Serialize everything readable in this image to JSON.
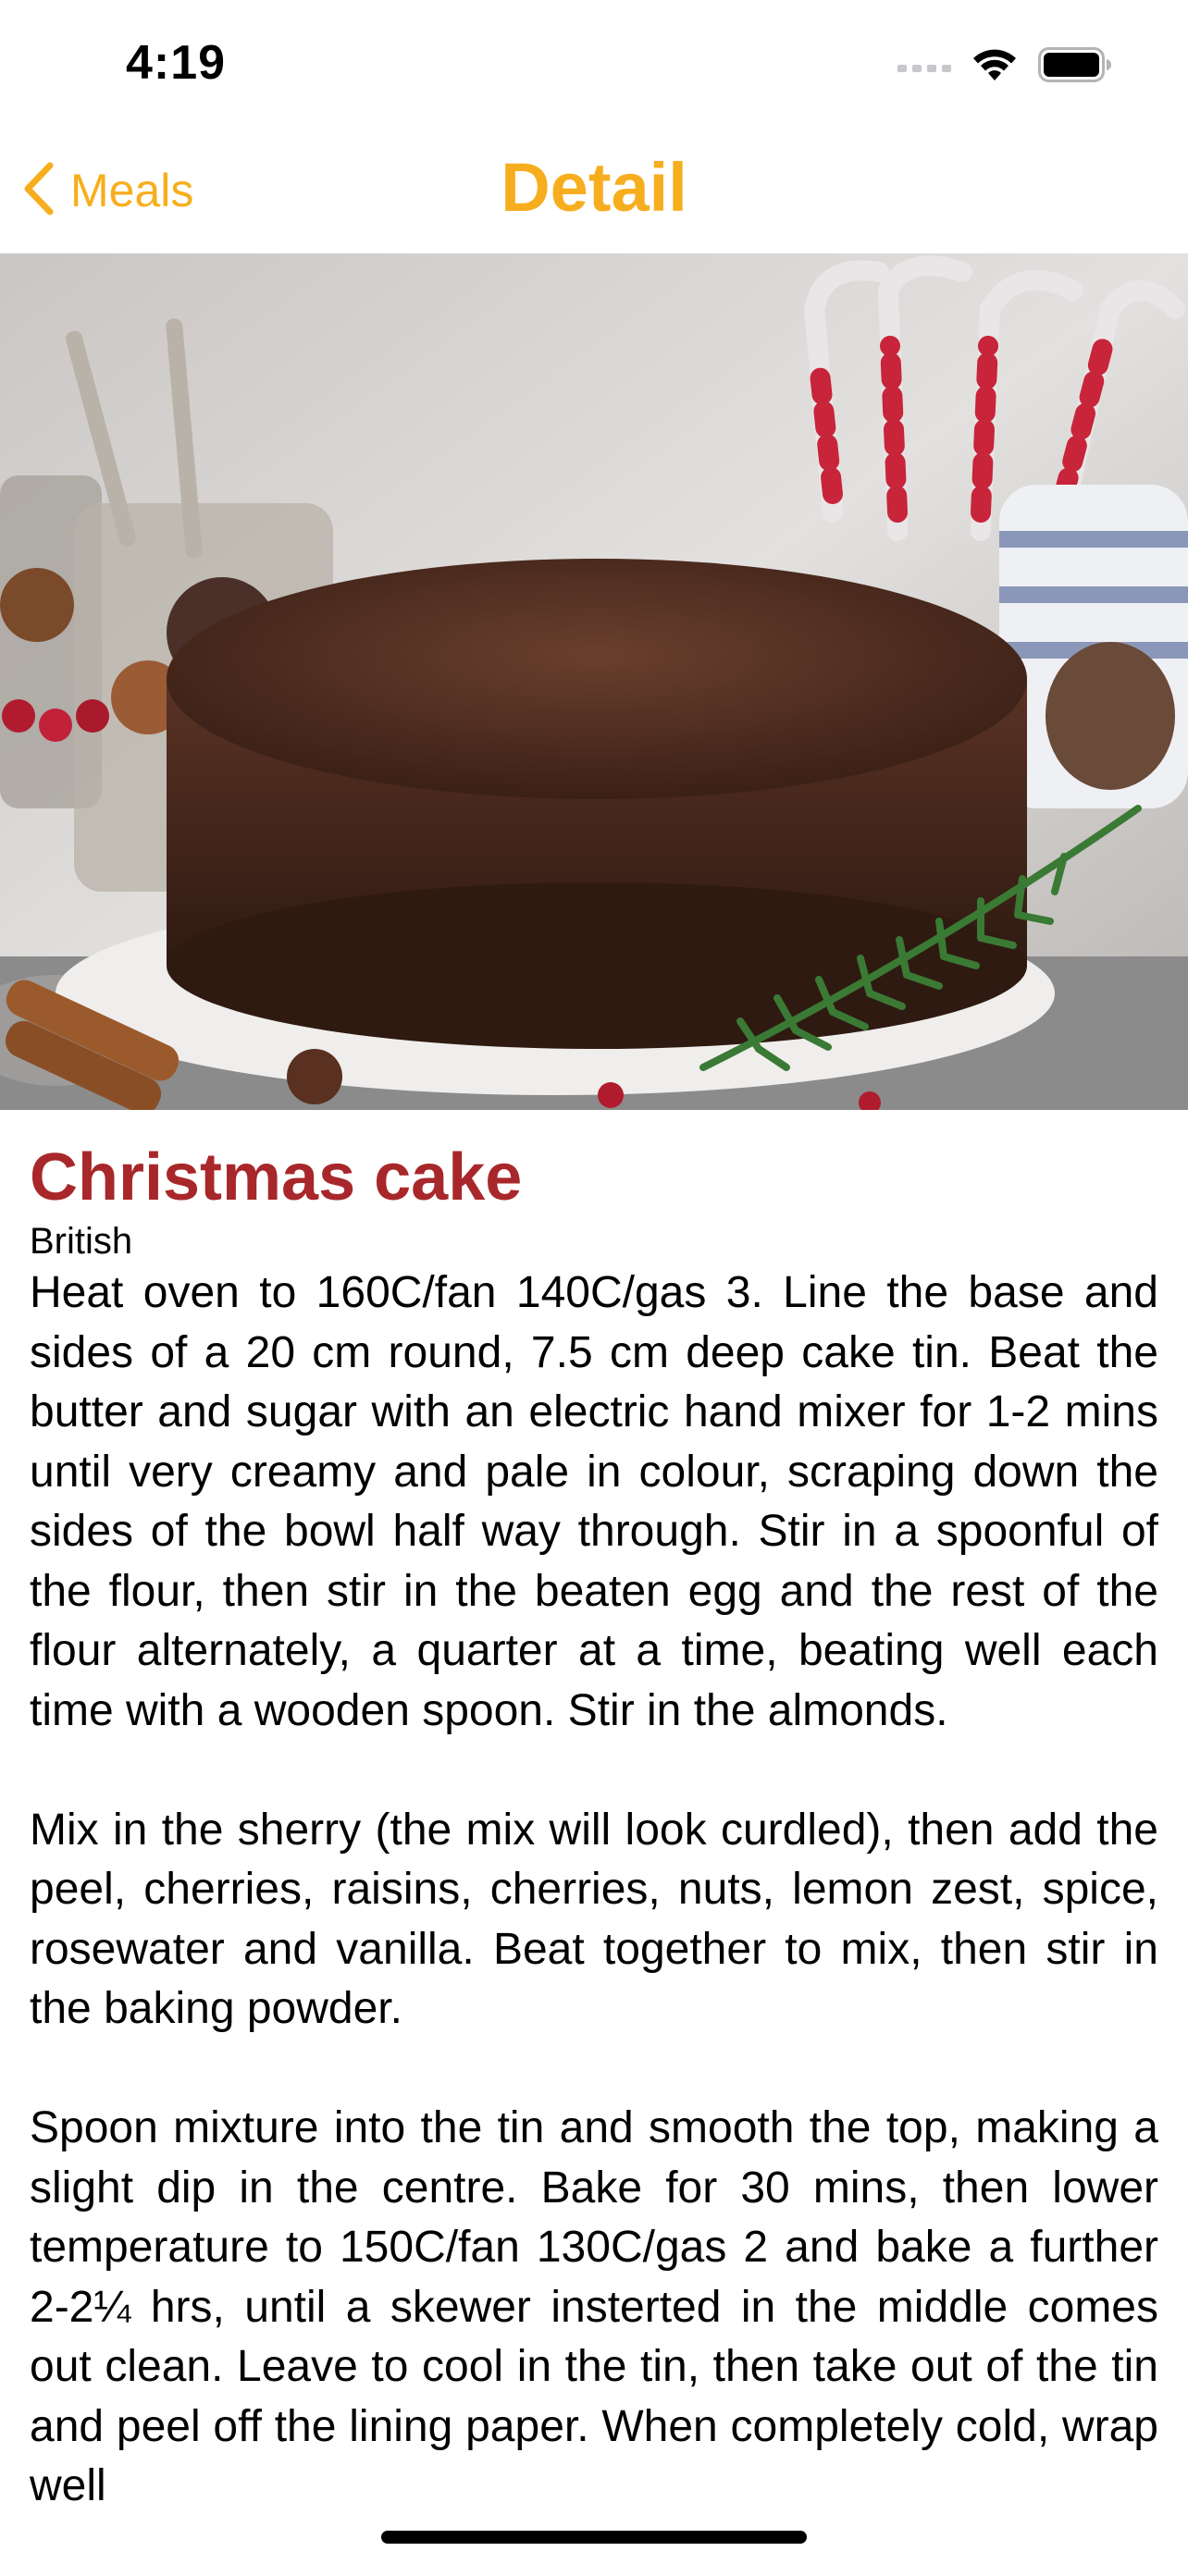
{
  "status_bar": {
    "time": "4:19"
  },
  "nav": {
    "back_label": "Meals",
    "title": "Detail"
  },
  "colors": {
    "accent": "#F7AE1E",
    "title_red": "#A8272A"
  },
  "meal": {
    "title": "Christmas cake",
    "area": "British",
    "instructions": [
      "Heat oven to 160C/fan 140C/gas 3. Line the base and sides of a 20 cm round, 7.5 cm deep cake tin. Beat the butter and sugar with an electric hand mixer for 1-2 mins until very creamy and pale in colour, scraping down the sides of the bowl half way through. Stir in a spoonful of the flour, then stir in the beaten egg and the rest of the flour alternately, a quarter at a time, beating well each time with a wooden spoon. Stir in the almonds.",
      "Mix in the sherry (the mix will look curdled), then add the peel, cherries, raisins, cherries, nuts, lemon zest, spice, rosewater and vanilla. Beat together to mix, then stir in the baking powder.",
      "Spoon mixture into the tin and smooth the top, making a slight dip in the centre. Bake for 30 mins, then lower temperature to 150C/fan 130C/gas 2 and bake a further 2-2¼ hrs, until a skewer insterted in the middle comes out clean. Leave to cool in the tin, then take out of the tin and peel off the lining paper. When completely cold, wrap well"
    ]
  },
  "icons": {
    "back": "chevron-left-icon",
    "signal": "cellular-signal-icon",
    "wifi": "wifi-icon",
    "battery": "battery-icon"
  }
}
